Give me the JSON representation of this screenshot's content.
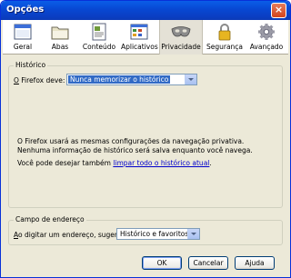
{
  "window": {
    "title": "Opções",
    "close_label": "×"
  },
  "toolbar": {
    "items": [
      {
        "label": "Geral",
        "icon": "window-icon"
      },
      {
        "label": "Abas",
        "icon": "folder-tabs-icon"
      },
      {
        "label": "Conteúdo",
        "icon": "content-page-icon"
      },
      {
        "label": "Aplicativos",
        "icon": "applications-window-icon"
      },
      {
        "label": "Privacidade",
        "icon": "privacy-mask-icon"
      },
      {
        "label": "Segurança",
        "icon": "padlock-icon"
      },
      {
        "label": "Avançado",
        "icon": "gear-icon"
      }
    ],
    "selected": "Privacidade"
  },
  "history": {
    "group_label": "Histórico",
    "firefox_will_label": "O Firefox deve:",
    "firefox_will_value": "Nunca memorizar o histórico",
    "info_text": "O Firefox usará as mesmas configurações da navegação privativa. Nenhuma informação de histórico será salva enquanto você navega.",
    "clear_prefix": "Você pode desejar também ",
    "clear_link": "limpar todo o histórico atual",
    "clear_suffix": "."
  },
  "address_bar": {
    "group_label": "Campo de endereço",
    "suggest_label": "Ao digitar um endereço, sugerir:",
    "suggest_value": "Histórico e favoritos"
  },
  "buttons": {
    "ok": "OK",
    "cancel": "Cancelar",
    "help": "Ajuda"
  },
  "colors": {
    "titlebar": "#0a3fc4",
    "dialog_bg": "#ece9d8",
    "selection": "#316ac5",
    "link": "#0000cc"
  }
}
